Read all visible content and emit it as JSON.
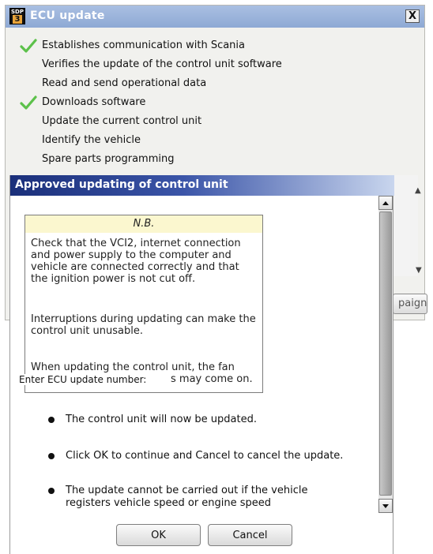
{
  "window": {
    "title": "ECU update",
    "logo_text_top": "SDP",
    "logo_text_bottom": "3",
    "close_label": "X"
  },
  "steps": [
    {
      "label": "Establishes communication with Scania",
      "done": true
    },
    {
      "label": "Verifies the update of the control unit software",
      "done": false
    },
    {
      "label": "Read and send operational data",
      "done": false
    },
    {
      "label": "Downloads software",
      "done": true
    },
    {
      "label": "Update the current control unit",
      "done": false
    },
    {
      "label": "Identify the vehicle",
      "done": false
    },
    {
      "label": "Spare parts programming",
      "done": false
    }
  ],
  "background": {
    "campaign_button_label": "paign"
  },
  "dialog": {
    "title": "Approved updating of control unit",
    "note": {
      "header": "N.B.",
      "paragraph1": "Check that the VCI2, internet connection and power supply to the computer and vehicle are connected correctly and that the ignition power is not cut off.",
      "paragraph2": "Interruptions during updating can make the control unit unusable.",
      "paragraph3_line1": "When updating the control unit, the fan",
      "paragraph3_line2_visible": "s may come on."
    },
    "ecu_label": "Enter ECU update number:",
    "bullets": [
      "The control unit will now be updated.",
      "Click OK to continue and Cancel to cancel the update.",
      "The update cannot be carried out if the vehicle registers vehicle speed or engine speed"
    ],
    "ok_label": "OK",
    "cancel_label": "Cancel"
  },
  "colors": {
    "check_green": "#5cc14a",
    "dialog_title_dark": "#1a2f7a",
    "note_header_bg": "#fbf7cf"
  }
}
